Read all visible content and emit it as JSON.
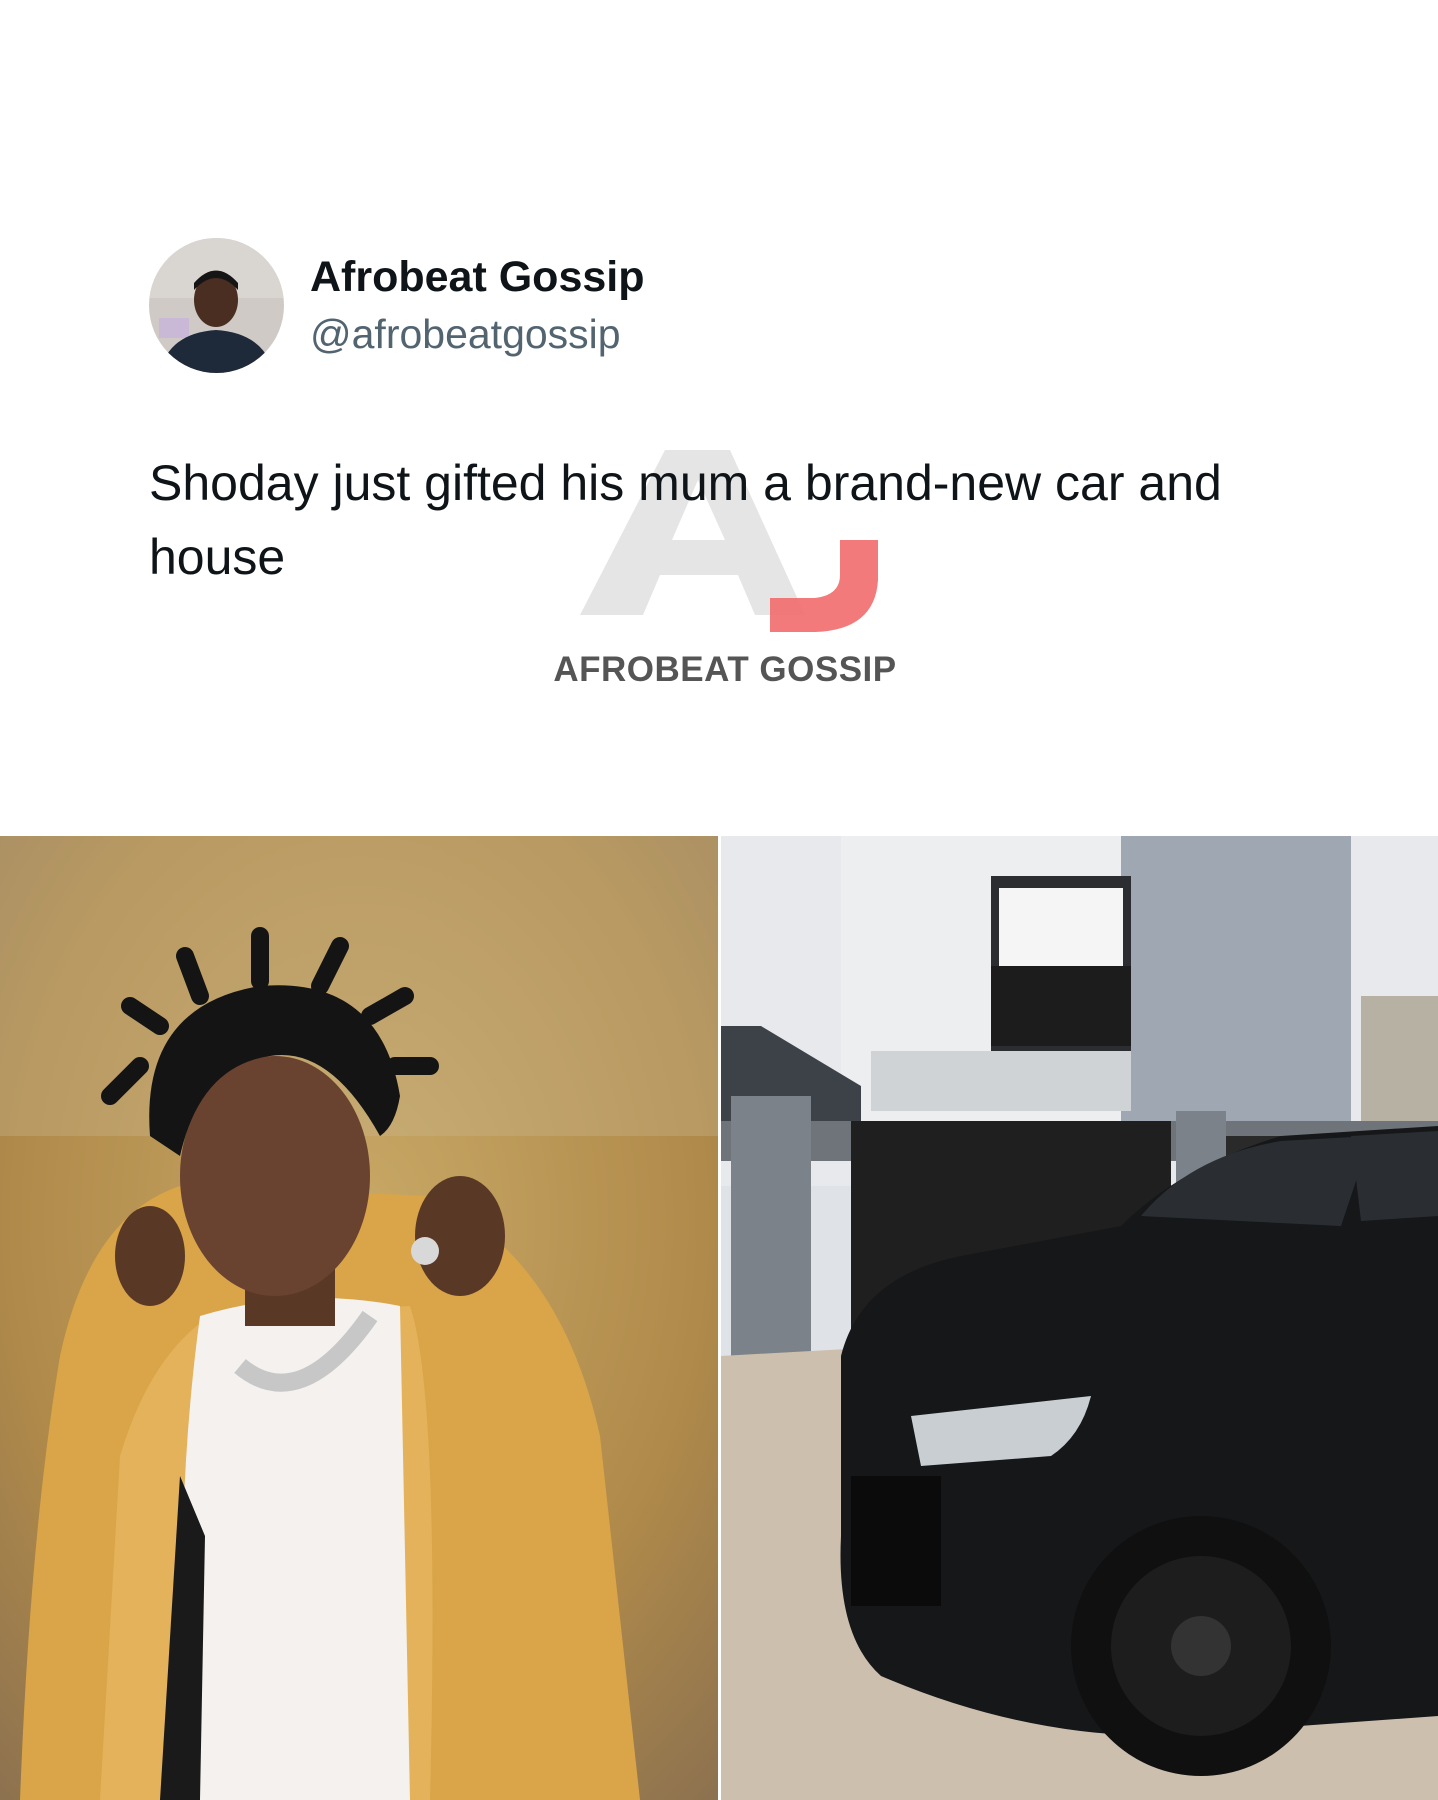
{
  "author": {
    "display_name": "Afrobeat Gossip",
    "handle": "@afrobeatgossip",
    "avatar_icon": "profile-photo"
  },
  "tweet": {
    "text": "Shoday just gifted his mum a brand-new car and house"
  },
  "watermark": {
    "logo_letters": "AG",
    "text": "AFROBEAT GOSSIP",
    "colors": {
      "a": "#e0e0e0",
      "g": "#f16b6b"
    }
  },
  "media": [
    {
      "name": "artist-portrait",
      "description_icon": "person-photo"
    },
    {
      "name": "house-and-car",
      "description_icon": "car-photo"
    }
  ],
  "colors": {
    "text_primary": "#0f1419",
    "text_secondary": "#536471",
    "background": "#ffffff"
  }
}
